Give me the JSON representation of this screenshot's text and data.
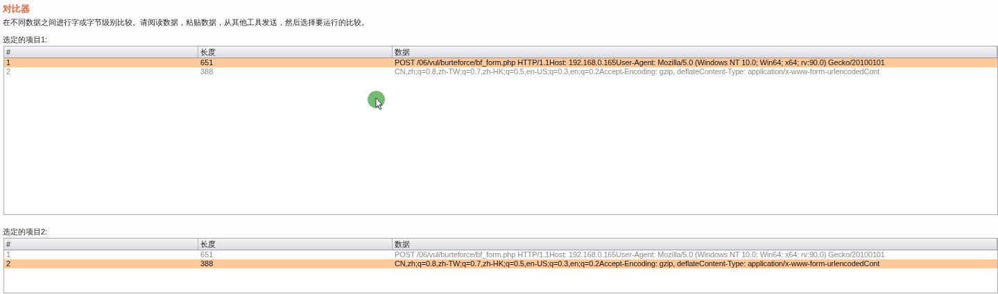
{
  "title": "对比器",
  "description": "在不同数据之间进行字或字节级别比较。请阅读数据，粘贴数据，从其他工具发送，然后选择要运行的比较。",
  "panels": [
    {
      "label": "选定的项目1:",
      "columns": [
        "#",
        "长度",
        "数据"
      ],
      "rows": [
        {
          "cells": [
            "1",
            "651",
            "POST /06/vul/burteforce/bf_form.php HTTP/1.1Host: 192.168.0.165User-Agent: Mozilla/5.0 (Windows NT 10.0; Win64; x64; rv:90.0) Gecko/20100101"
          ],
          "selected": true
        },
        {
          "cells": [
            "2",
            "388",
            "CN,zh;q=0.8,zh-TW;q=0.7,zh-HK;q=0.5,en-US;q=0.3,en;q=0.2Accept-Encoding: gzip, deflateContent-Type: application/x-www-form-urlencodedCont"
          ],
          "selected": false
        }
      ]
    },
    {
      "label": "选定的项目2:",
      "columns": [
        "#",
        "长度",
        "数据"
      ],
      "rows": [
        {
          "cells": [
            "1",
            "651",
            "POST /06/vul/burteforce/bf_form.php HTTP/1.1Host: 192.168.0.165User-Agent: Mozilla/5.0 (Windows NT 10.0; Win64; x64; rv:90.0) Gecko/20100101"
          ],
          "selected": false
        },
        {
          "cells": [
            "2",
            "388",
            "CN,zh;q=0.8,zh-TW;q=0.7,zh-HK;q=0.5,en-US;q=0.3,en;q=0.2Accept-Encoding: gzip, deflateContent-Type: application/x-www-form-urlencodedCont"
          ],
          "selected": true
        }
      ]
    }
  ]
}
